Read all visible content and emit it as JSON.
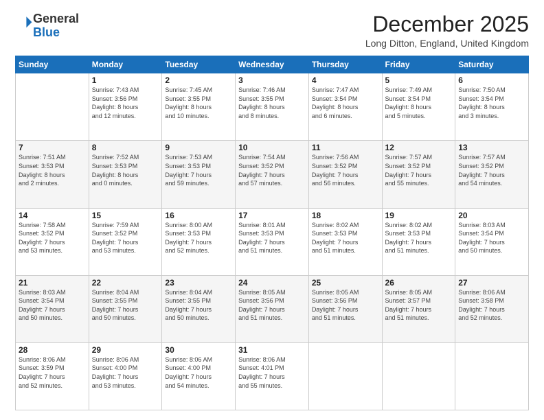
{
  "logo": {
    "general": "General",
    "blue": "Blue"
  },
  "header": {
    "month_year": "December 2025",
    "location": "Long Ditton, England, United Kingdom"
  },
  "weekdays": [
    "Sunday",
    "Monday",
    "Tuesday",
    "Wednesday",
    "Thursday",
    "Friday",
    "Saturday"
  ],
  "weeks": [
    [
      {
        "day": "",
        "info": ""
      },
      {
        "day": "1",
        "info": "Sunrise: 7:43 AM\nSunset: 3:56 PM\nDaylight: 8 hours\nand 12 minutes."
      },
      {
        "day": "2",
        "info": "Sunrise: 7:45 AM\nSunset: 3:55 PM\nDaylight: 8 hours\nand 10 minutes."
      },
      {
        "day": "3",
        "info": "Sunrise: 7:46 AM\nSunset: 3:55 PM\nDaylight: 8 hours\nand 8 minutes."
      },
      {
        "day": "4",
        "info": "Sunrise: 7:47 AM\nSunset: 3:54 PM\nDaylight: 8 hours\nand 6 minutes."
      },
      {
        "day": "5",
        "info": "Sunrise: 7:49 AM\nSunset: 3:54 PM\nDaylight: 8 hours\nand 5 minutes."
      },
      {
        "day": "6",
        "info": "Sunrise: 7:50 AM\nSunset: 3:54 PM\nDaylight: 8 hours\nand 3 minutes."
      }
    ],
    [
      {
        "day": "7",
        "info": "Sunrise: 7:51 AM\nSunset: 3:53 PM\nDaylight: 8 hours\nand 2 minutes."
      },
      {
        "day": "8",
        "info": "Sunrise: 7:52 AM\nSunset: 3:53 PM\nDaylight: 8 hours\nand 0 minutes."
      },
      {
        "day": "9",
        "info": "Sunrise: 7:53 AM\nSunset: 3:53 PM\nDaylight: 7 hours\nand 59 minutes."
      },
      {
        "day": "10",
        "info": "Sunrise: 7:54 AM\nSunset: 3:52 PM\nDaylight: 7 hours\nand 57 minutes."
      },
      {
        "day": "11",
        "info": "Sunrise: 7:56 AM\nSunset: 3:52 PM\nDaylight: 7 hours\nand 56 minutes."
      },
      {
        "day": "12",
        "info": "Sunrise: 7:57 AM\nSunset: 3:52 PM\nDaylight: 7 hours\nand 55 minutes."
      },
      {
        "day": "13",
        "info": "Sunrise: 7:57 AM\nSunset: 3:52 PM\nDaylight: 7 hours\nand 54 minutes."
      }
    ],
    [
      {
        "day": "14",
        "info": "Sunrise: 7:58 AM\nSunset: 3:52 PM\nDaylight: 7 hours\nand 53 minutes."
      },
      {
        "day": "15",
        "info": "Sunrise: 7:59 AM\nSunset: 3:52 PM\nDaylight: 7 hours\nand 53 minutes."
      },
      {
        "day": "16",
        "info": "Sunrise: 8:00 AM\nSunset: 3:53 PM\nDaylight: 7 hours\nand 52 minutes."
      },
      {
        "day": "17",
        "info": "Sunrise: 8:01 AM\nSunset: 3:53 PM\nDaylight: 7 hours\nand 51 minutes."
      },
      {
        "day": "18",
        "info": "Sunrise: 8:02 AM\nSunset: 3:53 PM\nDaylight: 7 hours\nand 51 minutes."
      },
      {
        "day": "19",
        "info": "Sunrise: 8:02 AM\nSunset: 3:53 PM\nDaylight: 7 hours\nand 51 minutes."
      },
      {
        "day": "20",
        "info": "Sunrise: 8:03 AM\nSunset: 3:54 PM\nDaylight: 7 hours\nand 50 minutes."
      }
    ],
    [
      {
        "day": "21",
        "info": "Sunrise: 8:03 AM\nSunset: 3:54 PM\nDaylight: 7 hours\nand 50 minutes."
      },
      {
        "day": "22",
        "info": "Sunrise: 8:04 AM\nSunset: 3:55 PM\nDaylight: 7 hours\nand 50 minutes."
      },
      {
        "day": "23",
        "info": "Sunrise: 8:04 AM\nSunset: 3:55 PM\nDaylight: 7 hours\nand 50 minutes."
      },
      {
        "day": "24",
        "info": "Sunrise: 8:05 AM\nSunset: 3:56 PM\nDaylight: 7 hours\nand 51 minutes."
      },
      {
        "day": "25",
        "info": "Sunrise: 8:05 AM\nSunset: 3:56 PM\nDaylight: 7 hours\nand 51 minutes."
      },
      {
        "day": "26",
        "info": "Sunrise: 8:05 AM\nSunset: 3:57 PM\nDaylight: 7 hours\nand 51 minutes."
      },
      {
        "day": "27",
        "info": "Sunrise: 8:06 AM\nSunset: 3:58 PM\nDaylight: 7 hours\nand 52 minutes."
      }
    ],
    [
      {
        "day": "28",
        "info": "Sunrise: 8:06 AM\nSunset: 3:59 PM\nDaylight: 7 hours\nand 52 minutes."
      },
      {
        "day": "29",
        "info": "Sunrise: 8:06 AM\nSunset: 4:00 PM\nDaylight: 7 hours\nand 53 minutes."
      },
      {
        "day": "30",
        "info": "Sunrise: 8:06 AM\nSunset: 4:00 PM\nDaylight: 7 hours\nand 54 minutes."
      },
      {
        "day": "31",
        "info": "Sunrise: 8:06 AM\nSunset: 4:01 PM\nDaylight: 7 hours\nand 55 minutes."
      },
      {
        "day": "",
        "info": ""
      },
      {
        "day": "",
        "info": ""
      },
      {
        "day": "",
        "info": ""
      }
    ]
  ]
}
